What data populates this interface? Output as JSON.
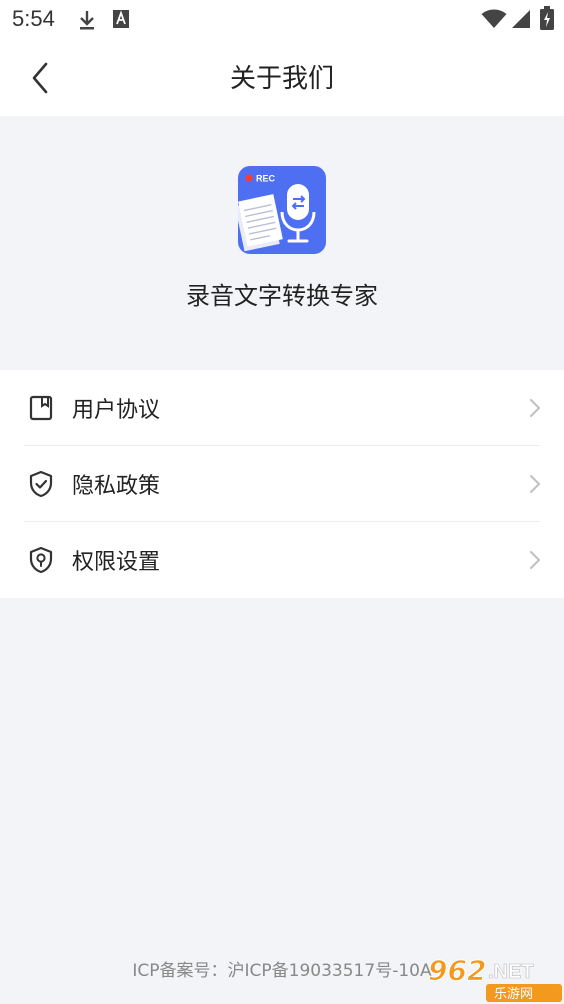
{
  "status_bar": {
    "time": "5:54",
    "icons": [
      "download-icon",
      "font-a-icon",
      "wifi-icon",
      "signal-icon",
      "battery-icon"
    ]
  },
  "header": {
    "title": "关于我们",
    "back_icon": "chevron-left-icon"
  },
  "app": {
    "name": "录音文字转换专家",
    "icon_badge": "REC",
    "icon_colors": {
      "primary": "#4f6ff2",
      "record_dot": "#ff3b30"
    }
  },
  "menu": {
    "items": [
      {
        "label": "用户协议",
        "icon": "bookmark-doc-icon"
      },
      {
        "label": "隐私政策",
        "icon": "shield-check-icon"
      },
      {
        "label": "权限设置",
        "icon": "shield-lock-icon"
      }
    ]
  },
  "footer": {
    "icp": "ICP备案号：沪ICP备19033517号-10A"
  },
  "watermark": {
    "number": "962",
    "domain": ".NET",
    "sub": "乐游网"
  },
  "colors": {
    "background": "#f3f4f7",
    "surface": "#ffffff",
    "text": "#222222",
    "muted": "#888888"
  }
}
